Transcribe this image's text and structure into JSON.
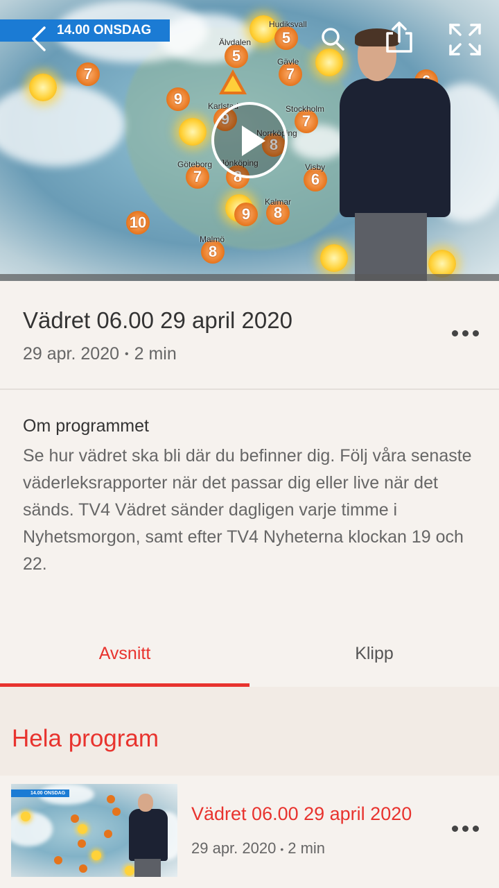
{
  "video": {
    "day_label": "14.00 ONSDAG",
    "cities": [
      "Hudiksvall",
      "Älvdalen",
      "Gävle",
      "Karlstad",
      "Stockholm",
      "Norrköping",
      "Göteborg",
      "Jönköping",
      "Visby",
      "Kalmar",
      "Malmö"
    ],
    "temperatures": [
      "5",
      "5",
      "7",
      "7",
      "9",
      "9",
      "7",
      "8",
      "7",
      "8",
      "6",
      "9",
      "8",
      "10",
      "8",
      "6",
      "9"
    ],
    "icons": [
      "back-icon",
      "search-icon",
      "share-icon",
      "fullscreen-icon",
      "play-icon"
    ]
  },
  "episode": {
    "title": "Vädret 06.00 29 april 2020",
    "date": "29 apr. 2020",
    "separator": "•",
    "duration": "2 min"
  },
  "about": {
    "heading": "Om programmet",
    "body": "Se hur vädret ska bli där du befinner dig. Följ våra senaste väderleksrapporter när det passar dig eller live när det sänds. TV4 Vädret sänder dagligen varje timme i Nyhetsmorgon, samt efter TV4 Nyheterna klockan 19 och 22."
  },
  "tabs": [
    {
      "label": "Avsnitt",
      "active": true
    },
    {
      "label": "Klipp",
      "active": false
    }
  ],
  "section": {
    "title": "Hela program"
  },
  "list": [
    {
      "thumb_label": "14.00 ONSDAG",
      "title": "Vädret 06.00 29 april 2020",
      "date": "29 apr. 2020",
      "separator": "•",
      "duration": "2 min"
    }
  ],
  "colors": {
    "accent": "#e8332e",
    "background": "#f6f2ee",
    "section_bg": "#f2ebe5",
    "band_blue": "#1b7bd4"
  }
}
